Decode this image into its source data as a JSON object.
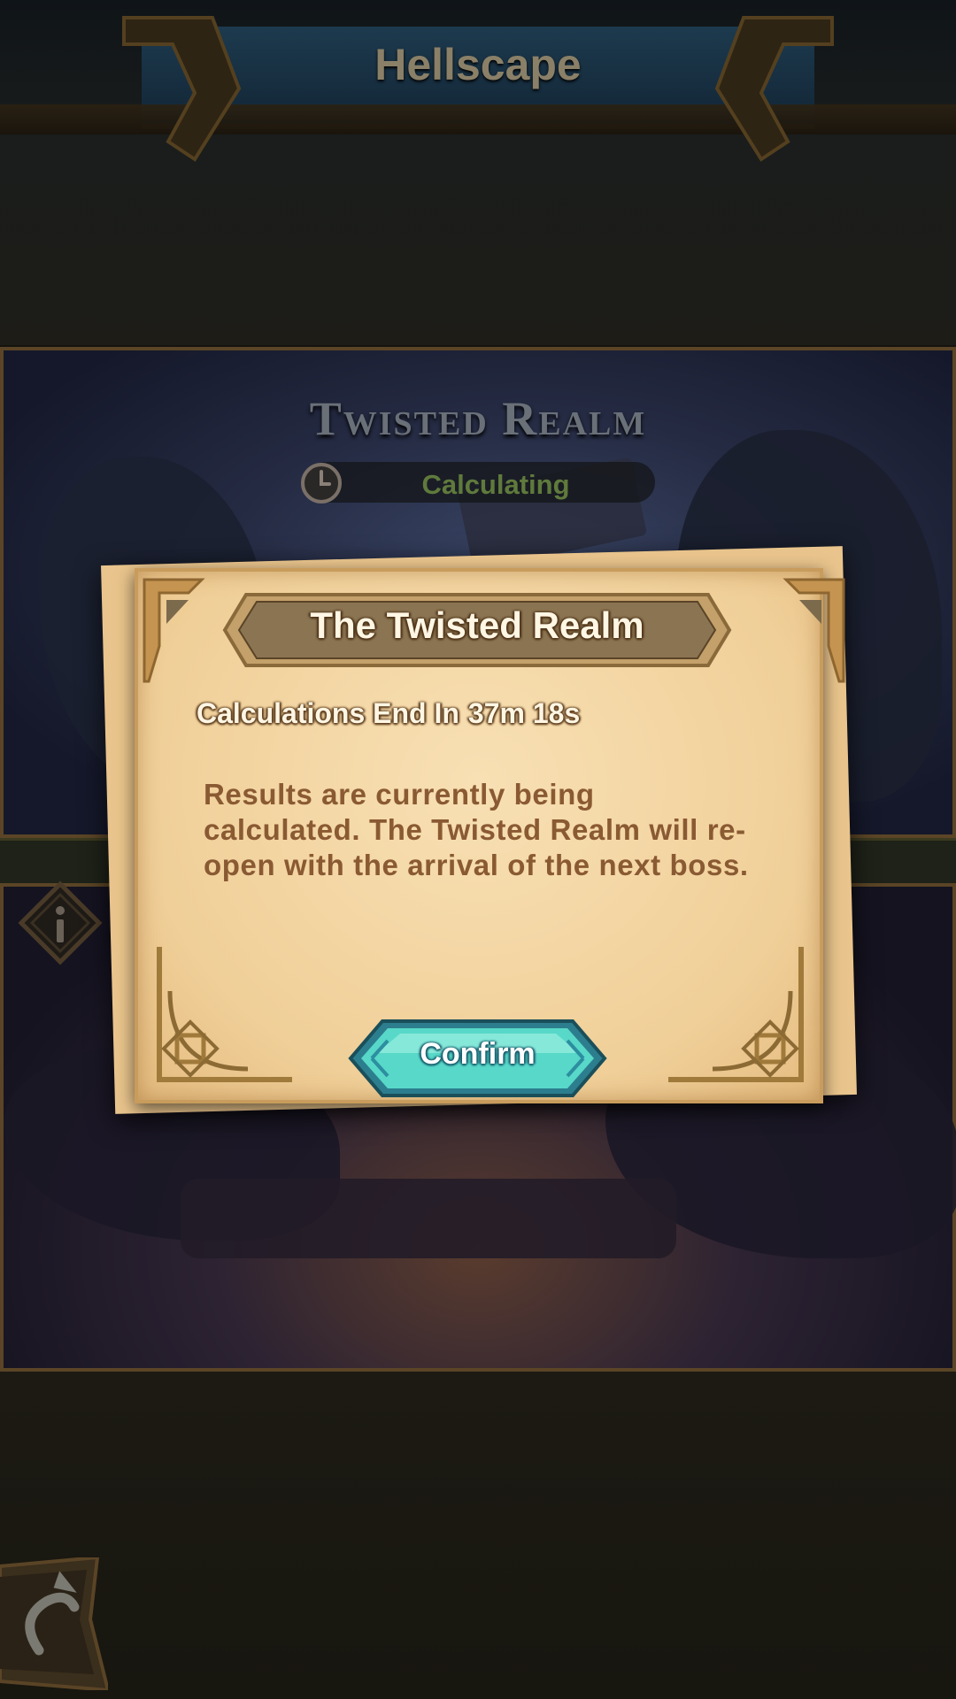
{
  "header": {
    "title": "Hellscape"
  },
  "event": {
    "title": "Twisted Realm",
    "status": "Calculating"
  },
  "dialog": {
    "title": "The Twisted Realm",
    "countdown_label": "Calculations End In",
    "countdown_value": "37m 18s",
    "body": "Results are currently being calculated. The Twisted Realm will re-open with the arrival of the next boss.",
    "confirm_label": "Confirm"
  },
  "icons": {
    "clock": "clock-icon",
    "info": "info-icon",
    "back": "back-arrow-icon"
  },
  "colors": {
    "parchment": "#f0cf98",
    "banner": "#8a7452",
    "confirm_button": "#4fd6c8",
    "status_text": "#5f7a3c"
  }
}
